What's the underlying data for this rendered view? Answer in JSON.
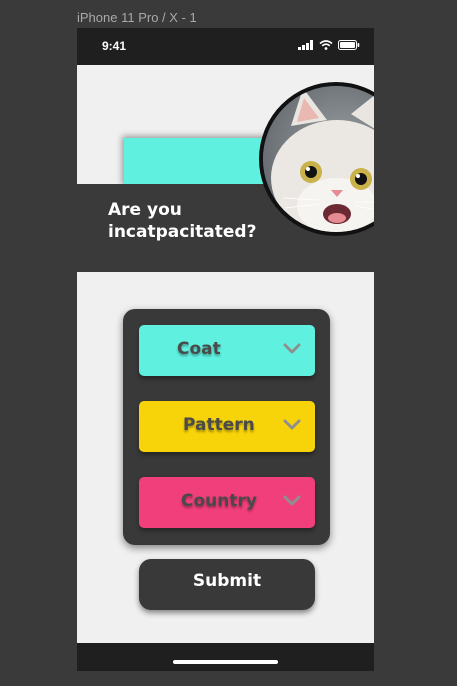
{
  "frame": {
    "label": "iPhone 11 Pro / X - 1"
  },
  "status_bar": {
    "time": "9:41",
    "icons": [
      "signal-icon",
      "wifi-icon",
      "battery-icon"
    ]
  },
  "header": {
    "title_line1": "Are you",
    "title_line2": "incatpacitated?",
    "image": "cat-photo"
  },
  "form": {
    "dropdowns": [
      {
        "label": "Coat",
        "color": "#5ff0e0"
      },
      {
        "label": "Pattern",
        "color": "#f7d309"
      },
      {
        "label": "Country",
        "color": "#f03f7a"
      }
    ],
    "submit_label": "Submit"
  },
  "colors": {
    "background": "#3a3a3a",
    "screen": "#f0f0f0",
    "accent_cyan": "#5ff0e0",
    "accent_yellow": "#f7d309",
    "accent_pink": "#f03f7a"
  }
}
